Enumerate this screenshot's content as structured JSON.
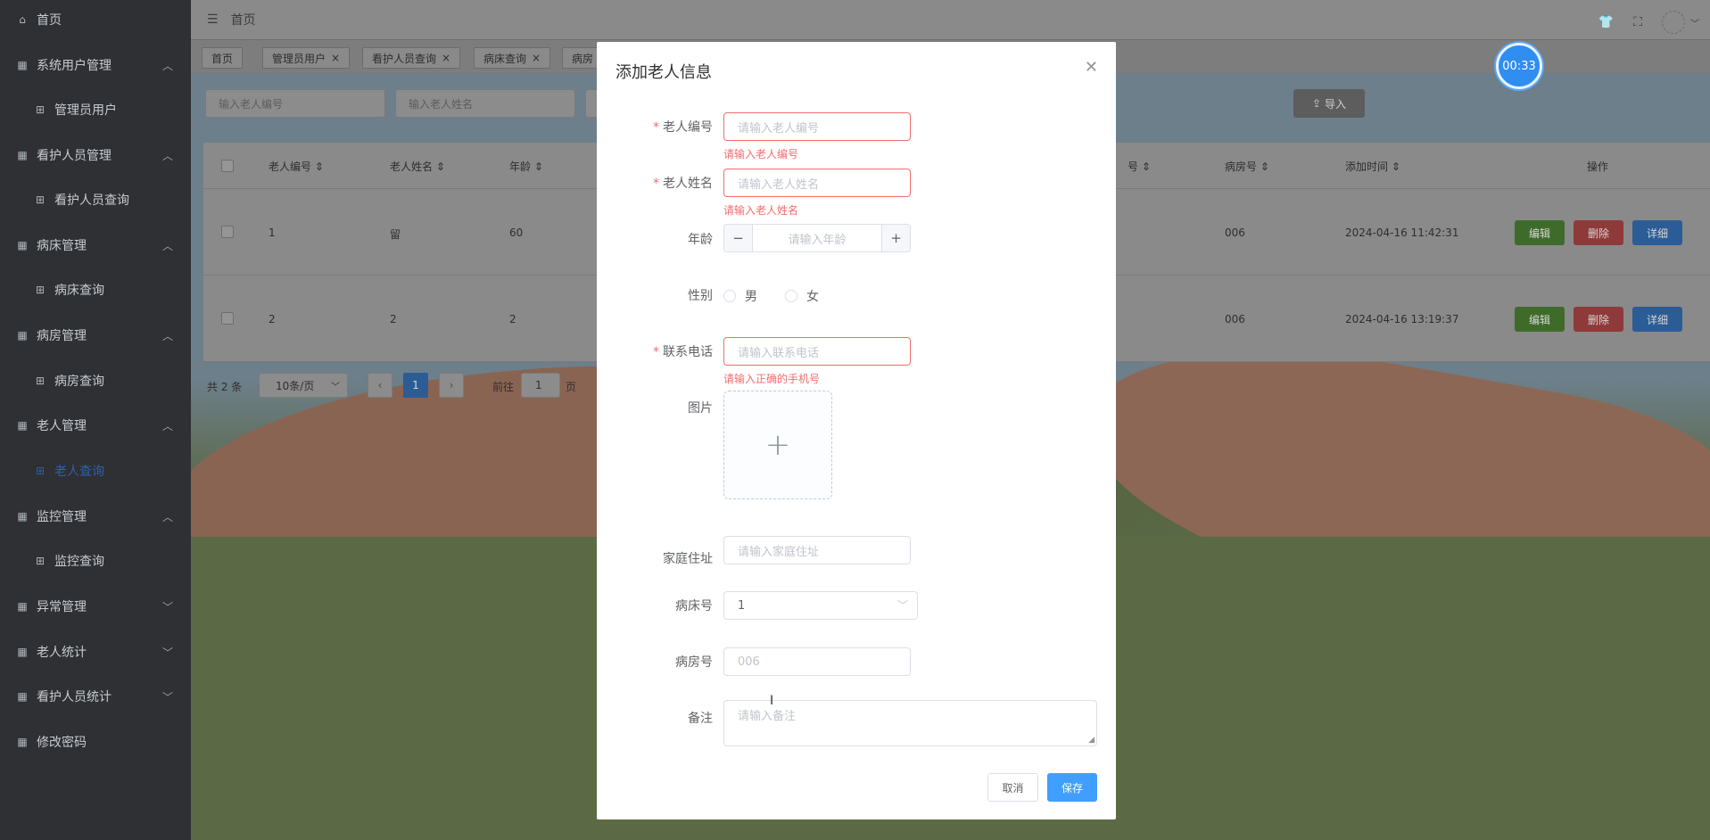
{
  "sidebar": {
    "items": [
      {
        "label": "首页",
        "icon": "home-icon"
      },
      {
        "label": "系统用户管理",
        "icon": "grid-icon"
      },
      {
        "label": "管理员用户",
        "icon": "apps-icon"
      },
      {
        "label": "看护人员管理",
        "icon": "grid-icon"
      },
      {
        "label": "看护人员查询",
        "icon": "apps-icon"
      },
      {
        "label": "病床管理",
        "icon": "grid-icon"
      },
      {
        "label": "病床查询",
        "icon": "apps-icon"
      },
      {
        "label": "病房管理",
        "icon": "grid-icon"
      },
      {
        "label": "病房查询",
        "icon": "apps-icon"
      },
      {
        "label": "老人管理",
        "icon": "grid-icon"
      },
      {
        "label": "老人查询",
        "icon": "apps-icon"
      },
      {
        "label": "监控管理",
        "icon": "grid-icon"
      },
      {
        "label": "监控查询",
        "icon": "apps-icon"
      },
      {
        "label": "异常管理",
        "icon": "grid-icon"
      },
      {
        "label": "老人统计",
        "icon": "grid-icon"
      },
      {
        "label": "看护人员统计",
        "icon": "grid-icon"
      },
      {
        "label": "修改密码",
        "icon": "grid-icon"
      }
    ]
  },
  "topbar": {
    "breadcrumb": "首页"
  },
  "tabs": [
    {
      "label": "首页"
    },
    {
      "label": "管理员用户"
    },
    {
      "label": "看护人员查询"
    },
    {
      "label": "病床查询"
    },
    {
      "label": "病房"
    }
  ],
  "search": {
    "elder_no_placeholder": "输入老人编号",
    "elder_name_placeholder": "输入老人姓名",
    "import_label": "导入"
  },
  "table": {
    "headers": [
      "老人编号",
      "老人姓名",
      "年龄",
      "号",
      "病房号",
      "添加时间",
      "操作"
    ],
    "rows": [
      {
        "no": "1",
        "name": "留",
        "age": "60",
        "room": "006",
        "time": "2024-04-16 11:42:31"
      },
      {
        "no": "2",
        "name": "2",
        "age": "2",
        "room": "006",
        "time": "2024-04-16 13:19:37"
      }
    ],
    "edit_label": "编辑",
    "delete_label": "删除",
    "detail_label": "详细"
  },
  "pager": {
    "total": "共 2 条",
    "size": "10条/页",
    "current": "1",
    "goto_label": "前往",
    "goto_value": "1",
    "page_unit": "页"
  },
  "timer": {
    "value": "00:33"
  },
  "dialog": {
    "title": "添加老人信息",
    "fields": {
      "elder_no": {
        "label": "老人编号",
        "placeholder": "请输入老人编号",
        "error": "请输入老人编号"
      },
      "elder_name": {
        "label": "老人姓名",
        "placeholder": "请输入老人姓名",
        "error": "请输入老人姓名"
      },
      "age": {
        "label": "年龄",
        "placeholder": "请输入年龄"
      },
      "gender": {
        "label": "性别",
        "options": [
          "男",
          "女"
        ]
      },
      "phone": {
        "label": "联系电话",
        "placeholder": "请输入联系电话",
        "error": "请输入正确的手机号"
      },
      "photo": {
        "label": "图片"
      },
      "address": {
        "label": "家庭住址",
        "placeholder": "请输入家庭住址"
      },
      "bed": {
        "label": "病床号",
        "value": "1"
      },
      "room": {
        "label": "病房号",
        "placeholder": "006"
      },
      "remark": {
        "label": "备注",
        "placeholder": "请输入备注"
      }
    },
    "cancel_label": "取消",
    "save_label": "保存"
  }
}
